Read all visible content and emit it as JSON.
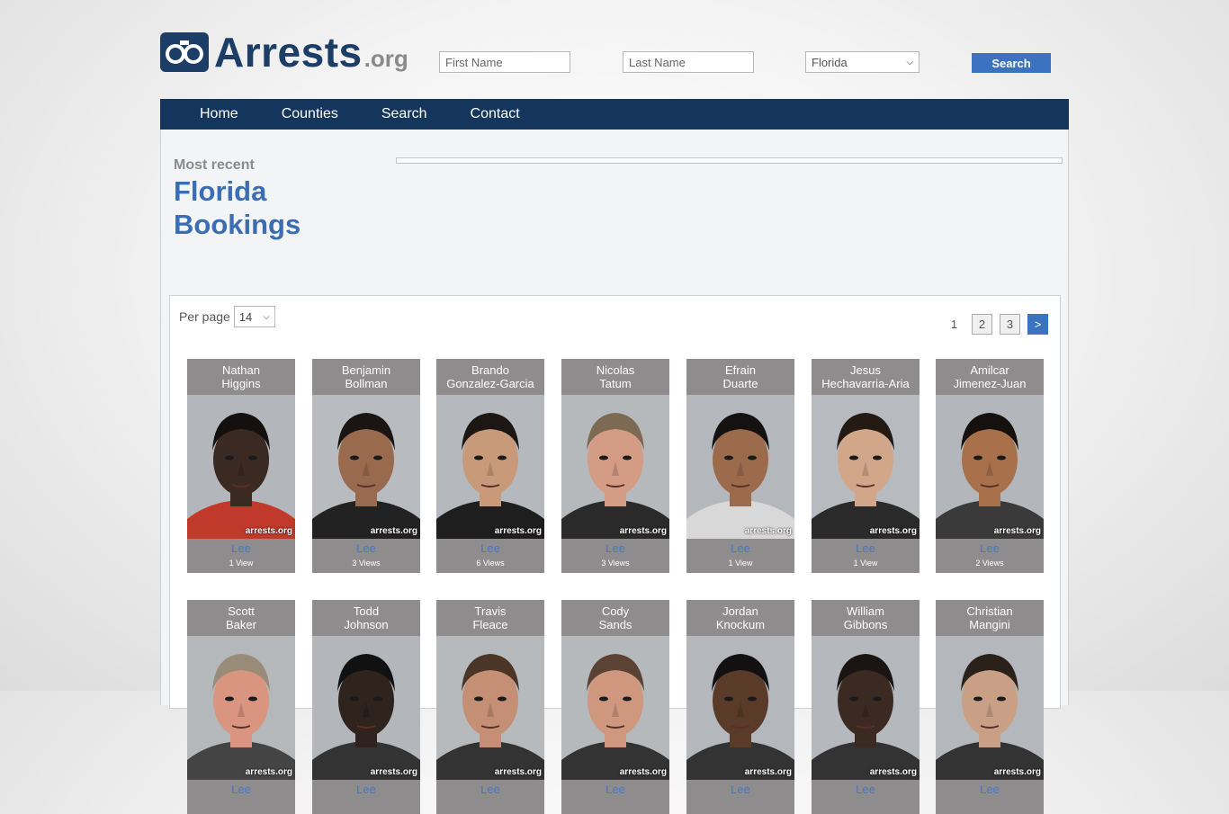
{
  "header": {
    "logo_text": "Arrests",
    "logo_tld": ".org",
    "first_name_placeholder": "First Name",
    "last_name_placeholder": "Last Name",
    "state_selected": "Florida",
    "search_label": "Search"
  },
  "nav": [
    "Home",
    "Counties",
    "Search",
    "Contact"
  ],
  "intro": {
    "kicker": "Most recent",
    "title_line1": "Florida",
    "title_line2": "Bookings"
  },
  "results": {
    "per_page_label": "Per page",
    "per_page_value": "14",
    "pagination": {
      "current": "1",
      "pages": [
        "2",
        "3"
      ],
      "next": ">"
    }
  },
  "watermark": "arrests.org",
  "inmates": [
    {
      "first": "Nathan",
      "last": "Higgins",
      "county": "Lee",
      "views": "1 View",
      "skin": "#3b2a22",
      "hair": "#141010",
      "bg": "#b3b7bb",
      "shirt": "#c0392b"
    },
    {
      "first": "Benjamin",
      "last": "Bollman",
      "county": "Lee",
      "views": "3 Views",
      "skin": "#9a6a4e",
      "hair": "#1a1512",
      "bg": "#b8bcc0",
      "shirt": "#222222"
    },
    {
      "first": "Brando",
      "last": "Gonzalez-Garcia",
      "county": "Lee",
      "views": "6 Views",
      "skin": "#c99a7a",
      "hair": "#1d1713",
      "bg": "#b5b9bd",
      "shirt": "#1e1e1e"
    },
    {
      "first": "Nicolas",
      "last": "Tatum",
      "county": "Lee",
      "views": "3 Views",
      "skin": "#d49b85",
      "hair": "#7d6a55",
      "bg": "#b6b9bc",
      "shirt": "#2a2a2a"
    },
    {
      "first": "Efrain",
      "last": "Duarte",
      "county": "Lee",
      "views": "1 View",
      "skin": "#9c6b4c",
      "hair": "#141210",
      "bg": "#b4b8bc",
      "shirt": "#d8d8d8"
    },
    {
      "first": "Jesus",
      "last": "Hechavarria-Aria",
      "county": "Lee",
      "views": "1 View",
      "skin": "#d2a688",
      "hair": "#231a14",
      "bg": "#b7bbbf",
      "shirt": "#2a2a2a"
    },
    {
      "first": "Amilcar",
      "last": "Jimenez-Juan",
      "county": "Lee",
      "views": "2 Views",
      "skin": "#a8714c",
      "hair": "#15110e",
      "bg": "#b3b7bb",
      "shirt": "#3a3a3a"
    },
    {
      "first": "Scott",
      "last": "Baker",
      "county": "Lee",
      "views": "",
      "skin": "#d99580",
      "hair": "#9a8a78",
      "bg": "#b5b8bb",
      "shirt": "#444444"
    },
    {
      "first": "Todd",
      "last": "Johnson",
      "county": "Lee",
      "views": "",
      "skin": "#2e231d",
      "hair": "#111111",
      "bg": "#b3b7bb",
      "shirt": "#333333"
    },
    {
      "first": "Travis",
      "last": "Fleace",
      "county": "Lee",
      "views": "",
      "skin": "#c48f74",
      "hair": "#4a3527",
      "bg": "#b6babd",
      "shirt": "#333333"
    },
    {
      "first": "Cody",
      "last": "Sands",
      "county": "Lee",
      "views": "",
      "skin": "#cf977e",
      "hair": "#5a4334",
      "bg": "#b6b9bc",
      "shirt": "#333333"
    },
    {
      "first": "Jordan",
      "last": "Knockum",
      "county": "Lee",
      "views": "",
      "skin": "#5a3b2a",
      "hair": "#121010",
      "bg": "#b4b8bc",
      "shirt": "#333333"
    },
    {
      "first": "William",
      "last": "Gibbons",
      "county": "Lee",
      "views": "",
      "skin": "#3b2a22",
      "hair": "#1a1412",
      "bg": "#b5b9bd",
      "shirt": "#333333"
    },
    {
      "first": "Christian",
      "last": "Mangini",
      "county": "Lee",
      "views": "",
      "skin": "#c9a085",
      "hair": "#2a211b",
      "bg": "#b4b8bc",
      "shirt": "#333333"
    }
  ]
}
